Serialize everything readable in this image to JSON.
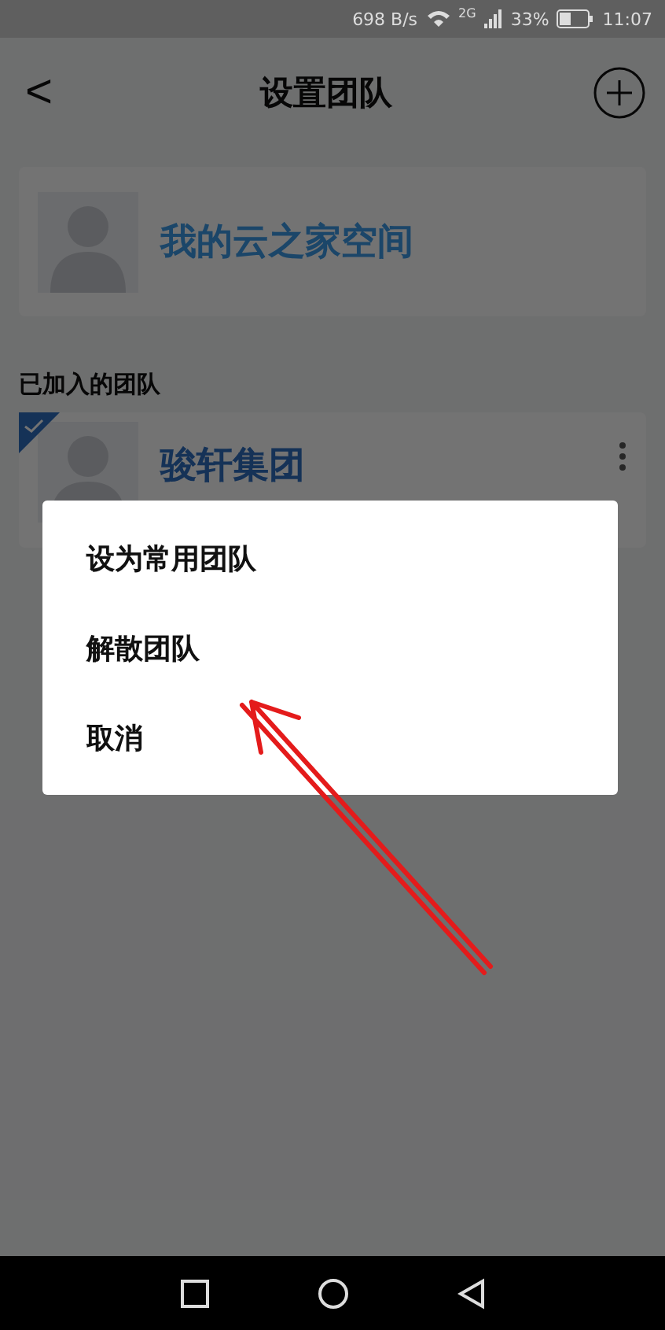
{
  "status_bar": {
    "speed": "698 B/s",
    "network": "2G",
    "battery": "33%",
    "time": "11:07"
  },
  "header": {
    "back": "<",
    "title": "设置团队"
  },
  "personal_space": {
    "name": "我的云之家空间"
  },
  "joined_section": {
    "label": "已加入的团队"
  },
  "teams": [
    {
      "name": "骏轩集团",
      "current": true
    }
  ],
  "menu": {
    "items": [
      {
        "label": "设为常用团队"
      },
      {
        "label": "解散团队"
      },
      {
        "label": "取消"
      }
    ]
  }
}
